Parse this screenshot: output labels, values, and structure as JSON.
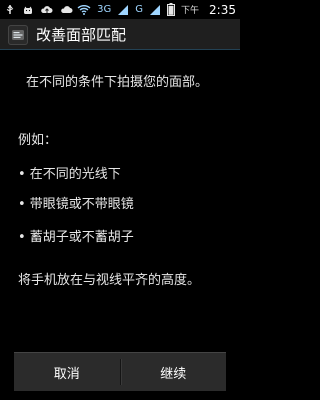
{
  "status_bar": {
    "left_icons": [
      "usb-icon",
      "android-debug-icon",
      "cloud-upload-icon",
      "cloud-icon"
    ],
    "right_icons": [
      "wifi-icon",
      "signal-3g-icon",
      "signal-g-icon",
      "battery-icon"
    ],
    "label_3g": "3G",
    "label_g": "G",
    "time_small": "下午",
    "time": "2:35"
  },
  "titlebar": {
    "title": "改善面部匹配"
  },
  "content": {
    "intro": "在不同的条件下拍摄您的面部。",
    "example_label": "例如：",
    "items": [
      "• 在不同的光线下",
      "• 带眼镜或不带眼镜",
      "• 蓄胡子或不蓄胡子"
    ],
    "note": "将手机放在与视线平齐的高度。"
  },
  "buttons": {
    "cancel": "取消",
    "continue": "继续"
  },
  "colors": {
    "status_blue": "#9fd5ff",
    "background": "#000000",
    "title_bg": "#1f1f1f",
    "button_bg": "#2b2b2b"
  }
}
